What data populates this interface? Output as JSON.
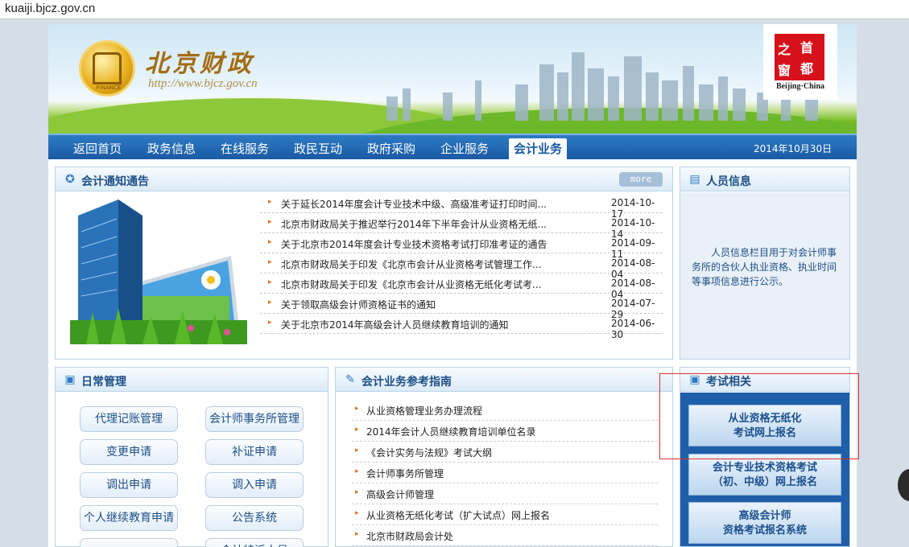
{
  "address_bar": {
    "url": "kuaiji.bjcz.gov.cn"
  },
  "banner": {
    "logo_text": "FINANCE",
    "brand_name": "北京财政",
    "brand_url": "http://www.bjcz.gov.cn",
    "seal_chars": [
      "之",
      "首",
      "窗",
      "都"
    ],
    "seal_caption": "Beijing·China"
  },
  "nav": {
    "items": [
      "返回首页",
      "政务信息",
      "在线服务",
      "政民互动",
      "政府采购",
      "企业服务",
      "会计业务"
    ],
    "active": "会计业务",
    "date": "2014年10月30日"
  },
  "notices": {
    "title": "会计通知通告",
    "more_label": "more",
    "items": [
      {
        "title": "关于延长2014年度会计专业技术中级、高级准考证打印时间...",
        "date": "2014-10-17"
      },
      {
        "title": "北京市财政局关于推迟举行2014年下半年会计从业资格无纸...",
        "date": "2014-10-14"
      },
      {
        "title": "关于北京市2014年度会计专业技术资格考试打印准考证的通告",
        "date": "2014-09-11"
      },
      {
        "title": "北京市财政局关于印发《北京市会计从业资格考试管理工作...",
        "date": "2014-08-04"
      },
      {
        "title": "北京市财政局关于印发《北京市会计从业资格无纸化考试考...",
        "date": "2014-08-04"
      },
      {
        "title": "关于领取高级会计师资格证书的通知",
        "date": "2014-07-29"
      },
      {
        "title": "关于北京市2014年高级会计人员继续教育培训的通知",
        "date": "2014-06-30"
      }
    ]
  },
  "personnel": {
    "title": "人员信息",
    "text": "人员信息栏目用于对会计师事务所的合伙人执业资格、执业时间等事项信息进行公示。"
  },
  "daily": {
    "title": "日常管理",
    "buttons": [
      "代理记账管理",
      "会计师事务所管理",
      "变更申请",
      "补证申请",
      "调出申请",
      "调入申请",
      "个人继续教育申请",
      "公告系统",
      "",
      "会计特派人员"
    ]
  },
  "guide": {
    "title": "会计业务参考指南",
    "items": [
      "从业资格管理业务办理流程",
      "2014年会计人员继续教育培训单位名录",
      "《会计实务与法规》考试大纲",
      "会计师事务所管理",
      "高级会计师管理",
      "从业资格无纸化考试（扩大试点）网上报名",
      "北京市财政局会计处"
    ]
  },
  "exam": {
    "title": "考试相关",
    "buttons": [
      {
        "line1": "从业资格无纸化",
        "line2": "考试网上报名"
      },
      {
        "line1": "会计专业技术资格考试",
        "line2": "（初、中级）网上报名"
      },
      {
        "line1": "高级会计师",
        "line2": "资格考试报名系统"
      }
    ]
  }
}
